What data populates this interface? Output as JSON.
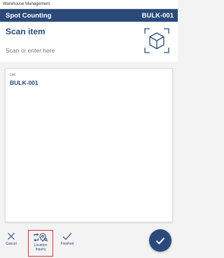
{
  "window": {
    "title": "Warehouse Management"
  },
  "header": {
    "title": "Spot Counting",
    "location": "BULK-001"
  },
  "scan": {
    "title": "Scan item",
    "placeholder": "Scan or enter here",
    "icon": "scan-box-icon"
  },
  "card": {
    "label": "Loc",
    "value": "BULK-001"
  },
  "toolbar": {
    "cancel": {
      "label": "Cancel",
      "icon": "close-icon"
    },
    "location_inquiry": {
      "label": "Location Inquiry",
      "icon": "location-inquiry-icon"
    },
    "finished": {
      "label": "Finished",
      "icon": "checkmark-icon"
    }
  },
  "fab": {
    "icon": "checkmark-icon"
  },
  "colors": {
    "primary": "#2b4a7a",
    "highlight": "#e0303a",
    "background": "#f3f3f3"
  }
}
